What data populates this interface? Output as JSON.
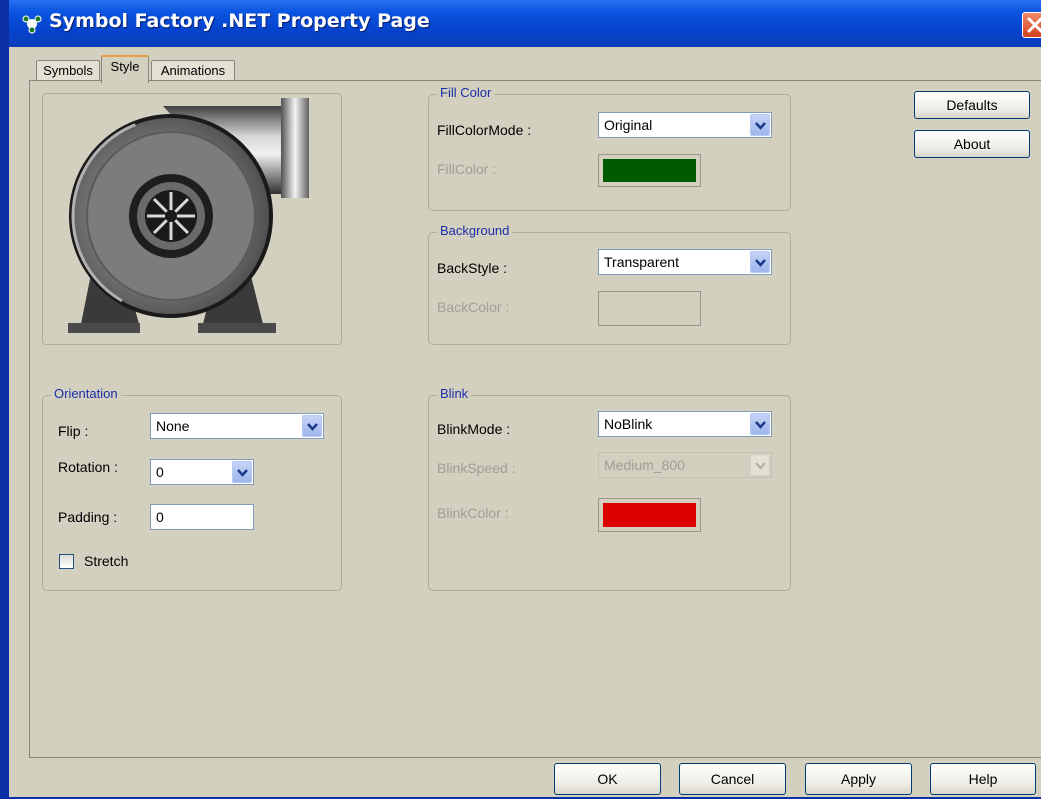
{
  "window": {
    "title": "Symbol Factory .NET Property Page"
  },
  "tabs": [
    {
      "label": "Symbols"
    },
    {
      "label": "Style"
    },
    {
      "label": "Animations"
    }
  ],
  "fill_color": {
    "title": "Fill Color",
    "mode_label": "FillColorMode :",
    "mode_value": "Original",
    "color_label": "FillColor :",
    "color": "#005a00"
  },
  "background": {
    "title": "Background",
    "style_label": "BackStyle :",
    "style_value": "Transparent",
    "color_label": "BackColor :"
  },
  "blink": {
    "title": "Blink",
    "mode_label": "BlinkMode :",
    "mode_value": "NoBlink",
    "speed_label": "BlinkSpeed :",
    "speed_value": "Medium_800",
    "color_label": "BlinkColor :",
    "color": "#dd0000"
  },
  "orientation": {
    "title": "Orientation",
    "flip_label": "Flip :",
    "flip_value": "None",
    "rotation_label": "Rotation :",
    "rotation_value": "0",
    "padding_label": "Padding :",
    "padding_value": "0",
    "stretch_label": "Stretch"
  },
  "side_buttons": {
    "defaults": "Defaults",
    "about": "About"
  },
  "footer": {
    "ok": "OK",
    "cancel": "Cancel",
    "apply": "Apply",
    "help": "Help"
  },
  "icons": {
    "app": "symbol-factory-icon",
    "close": "close-icon",
    "preview": "blower-pump-symbol"
  }
}
